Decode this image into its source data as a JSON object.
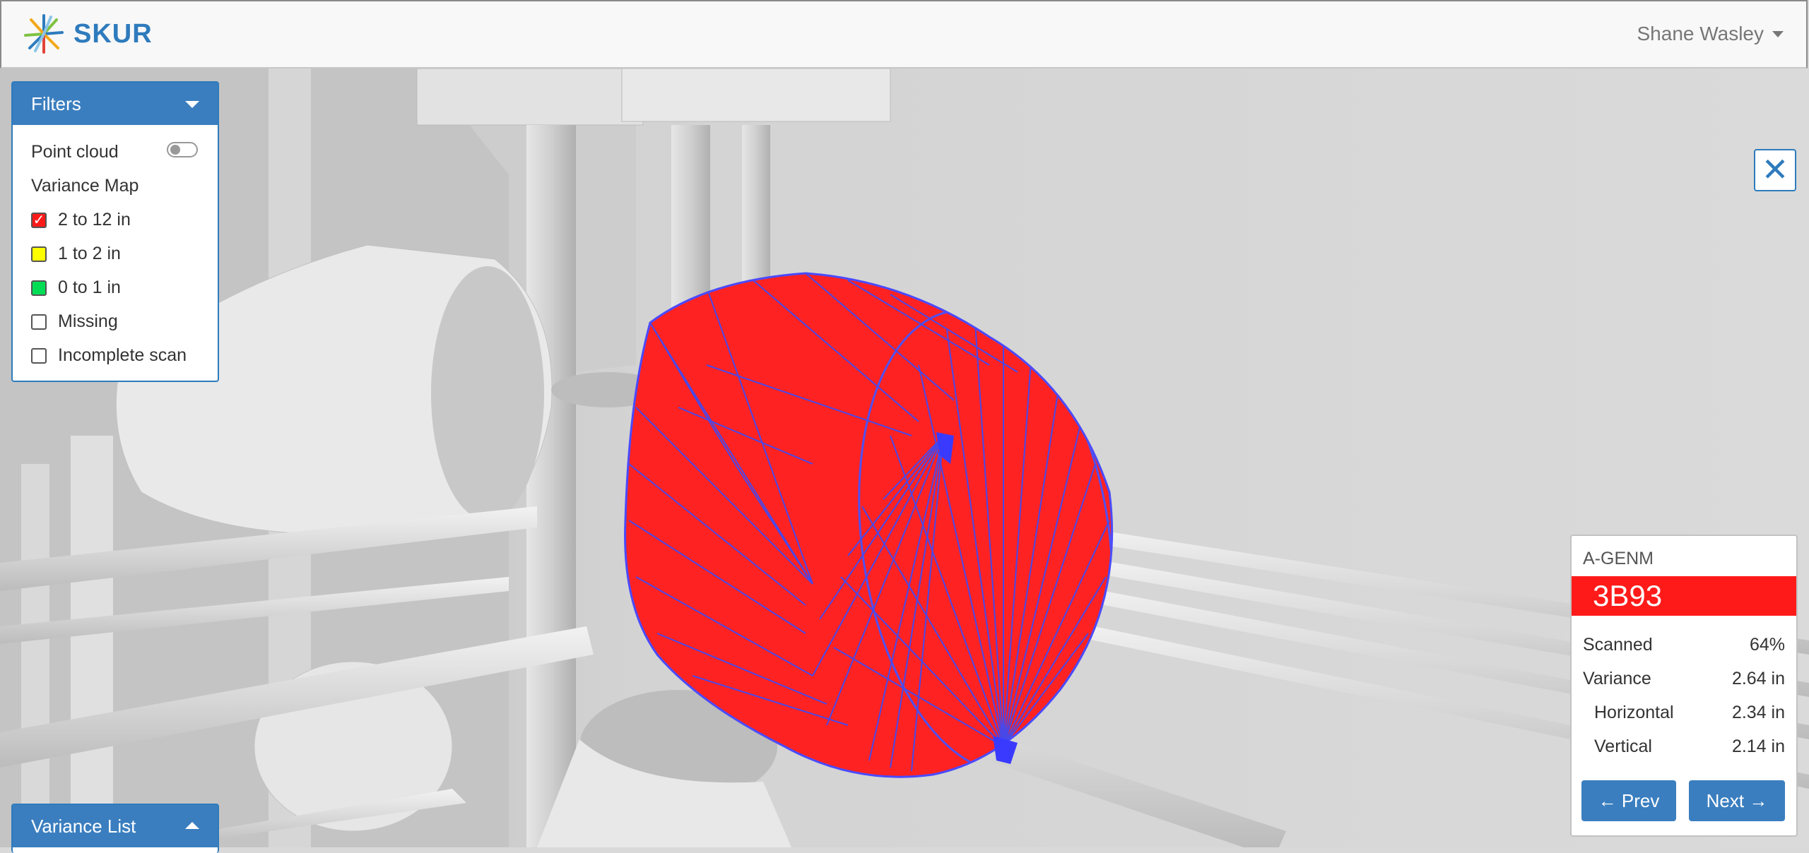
{
  "header": {
    "brand": "SKUR",
    "user_name": "Shane Wasley"
  },
  "filters": {
    "title": "Filters",
    "point_cloud_label": "Point cloud",
    "point_cloud_on": false,
    "variance_map_label": "Variance Map",
    "options": [
      {
        "label": "2 to 12 in",
        "checked": true,
        "color": "#ff1a1a"
      },
      {
        "label": "1 to 2 in",
        "checked": false,
        "color": "#ffff00"
      },
      {
        "label": "0 to 1 in",
        "checked": false,
        "color": "#00dd55"
      },
      {
        "label": "Missing",
        "checked": false,
        "color": "#ffffff"
      },
      {
        "label": "Incomplete scan",
        "checked": false,
        "color": "#ffffff"
      }
    ]
  },
  "variance_list": {
    "title": "Variance List"
  },
  "close": {
    "symbol": "✕"
  },
  "element_info": {
    "category": "A-GENM",
    "id": "3B93",
    "id_color": "#ff1a1a",
    "scanned_label": "Scanned",
    "scanned_value": "64%",
    "variance_label": "Variance",
    "variance_value": "2.64 in",
    "horizontal_label": "Horizontal",
    "horizontal_value": "2.34 in",
    "vertical_label": "Vertical",
    "vertical_value": "2.14 in",
    "prev_label": "← Prev",
    "next_label": "Next →"
  },
  "colors": {
    "accent": "#3a7ebf",
    "highlight": "#ff1a1a",
    "mesh_edge": "#3b3bff"
  }
}
